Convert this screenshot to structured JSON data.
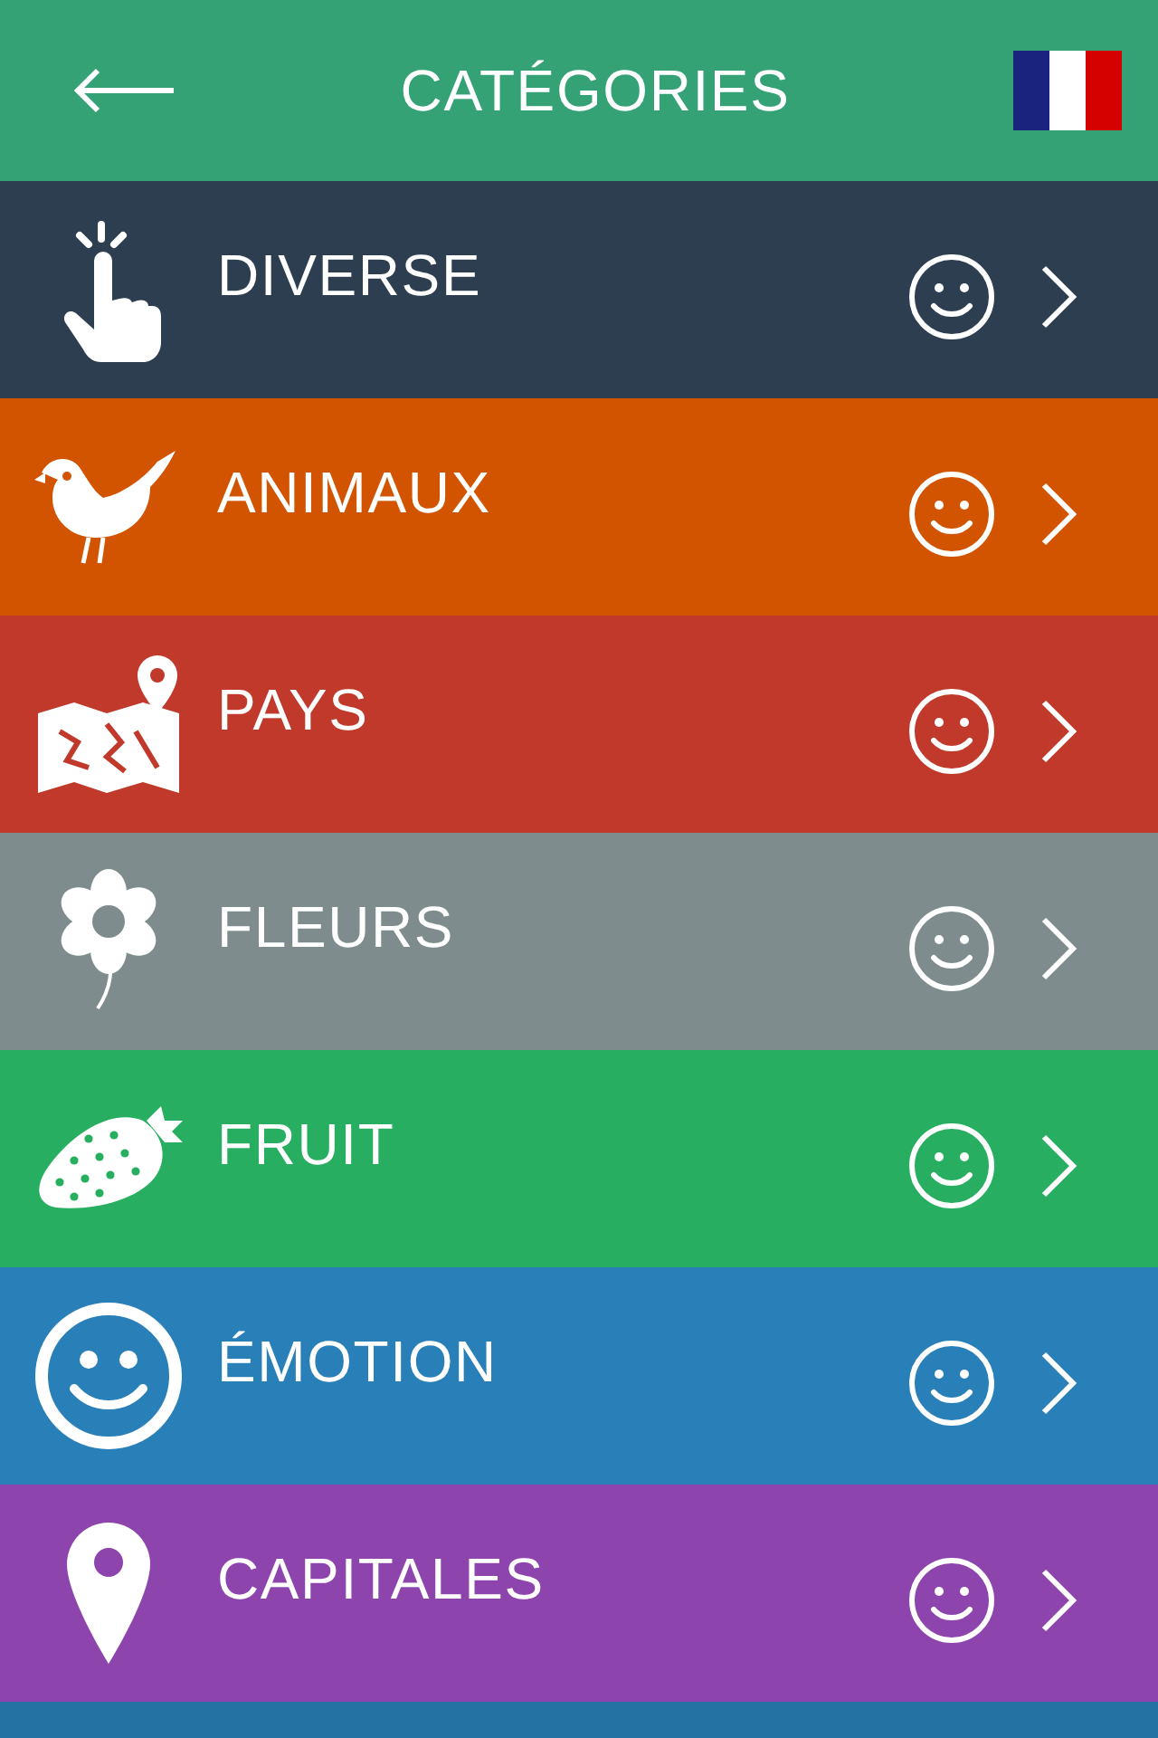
{
  "header": {
    "title": "CATÉGORIES"
  },
  "categories": [
    {
      "label": "DIVERSE",
      "color": "#2c3e50"
    },
    {
      "label": "ANIMAUX",
      "color": "#d35400"
    },
    {
      "label": "PAYS",
      "color": "#c0392b"
    },
    {
      "label": "FLEURS",
      "color": "#7f8c8d"
    },
    {
      "label": "FRUIT",
      "color": "#27ae60"
    },
    {
      "label": "ÉMOTION",
      "color": "#2980b9"
    },
    {
      "label": "CAPITALES",
      "color": "#8e44ad"
    }
  ],
  "partial_row": {
    "color": "#2471a3"
  }
}
